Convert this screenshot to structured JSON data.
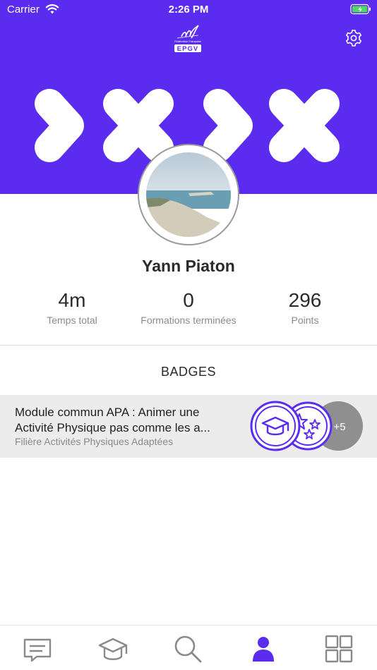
{
  "status_bar": {
    "carrier": "Carrier",
    "time": "2:26 PM"
  },
  "colors": {
    "primary": "#5b2cf0",
    "badge_row_bg": "#ececec",
    "more_circle": "#8f8f8f"
  },
  "header": {
    "logo_text": "EPGV",
    "settings_icon": "gear-icon"
  },
  "profile": {
    "name": "Yann Piaton"
  },
  "stats": [
    {
      "value": "4m",
      "label": "Temps total"
    },
    {
      "value": "0",
      "label": "Formations terminées"
    },
    {
      "value": "296",
      "label": "Points"
    }
  ],
  "badges": {
    "title": "BADGES",
    "items": [
      {
        "title_line1": "Module commun APA : Animer une",
        "title_line2": "Activité Physique pas comme les a...",
        "subtitle": "Filière Activités Physiques Adaptées",
        "badge_icons": [
          "graduation-cap-icon",
          "stars-icon"
        ],
        "more_count": "+5"
      }
    ]
  },
  "tab_bar": {
    "items": [
      {
        "icon": "message-icon",
        "active": false
      },
      {
        "icon": "graduation-cap-icon",
        "active": false
      },
      {
        "icon": "search-icon",
        "active": false
      },
      {
        "icon": "profile-icon",
        "active": true
      },
      {
        "icon": "grid-icon",
        "active": false
      }
    ]
  }
}
